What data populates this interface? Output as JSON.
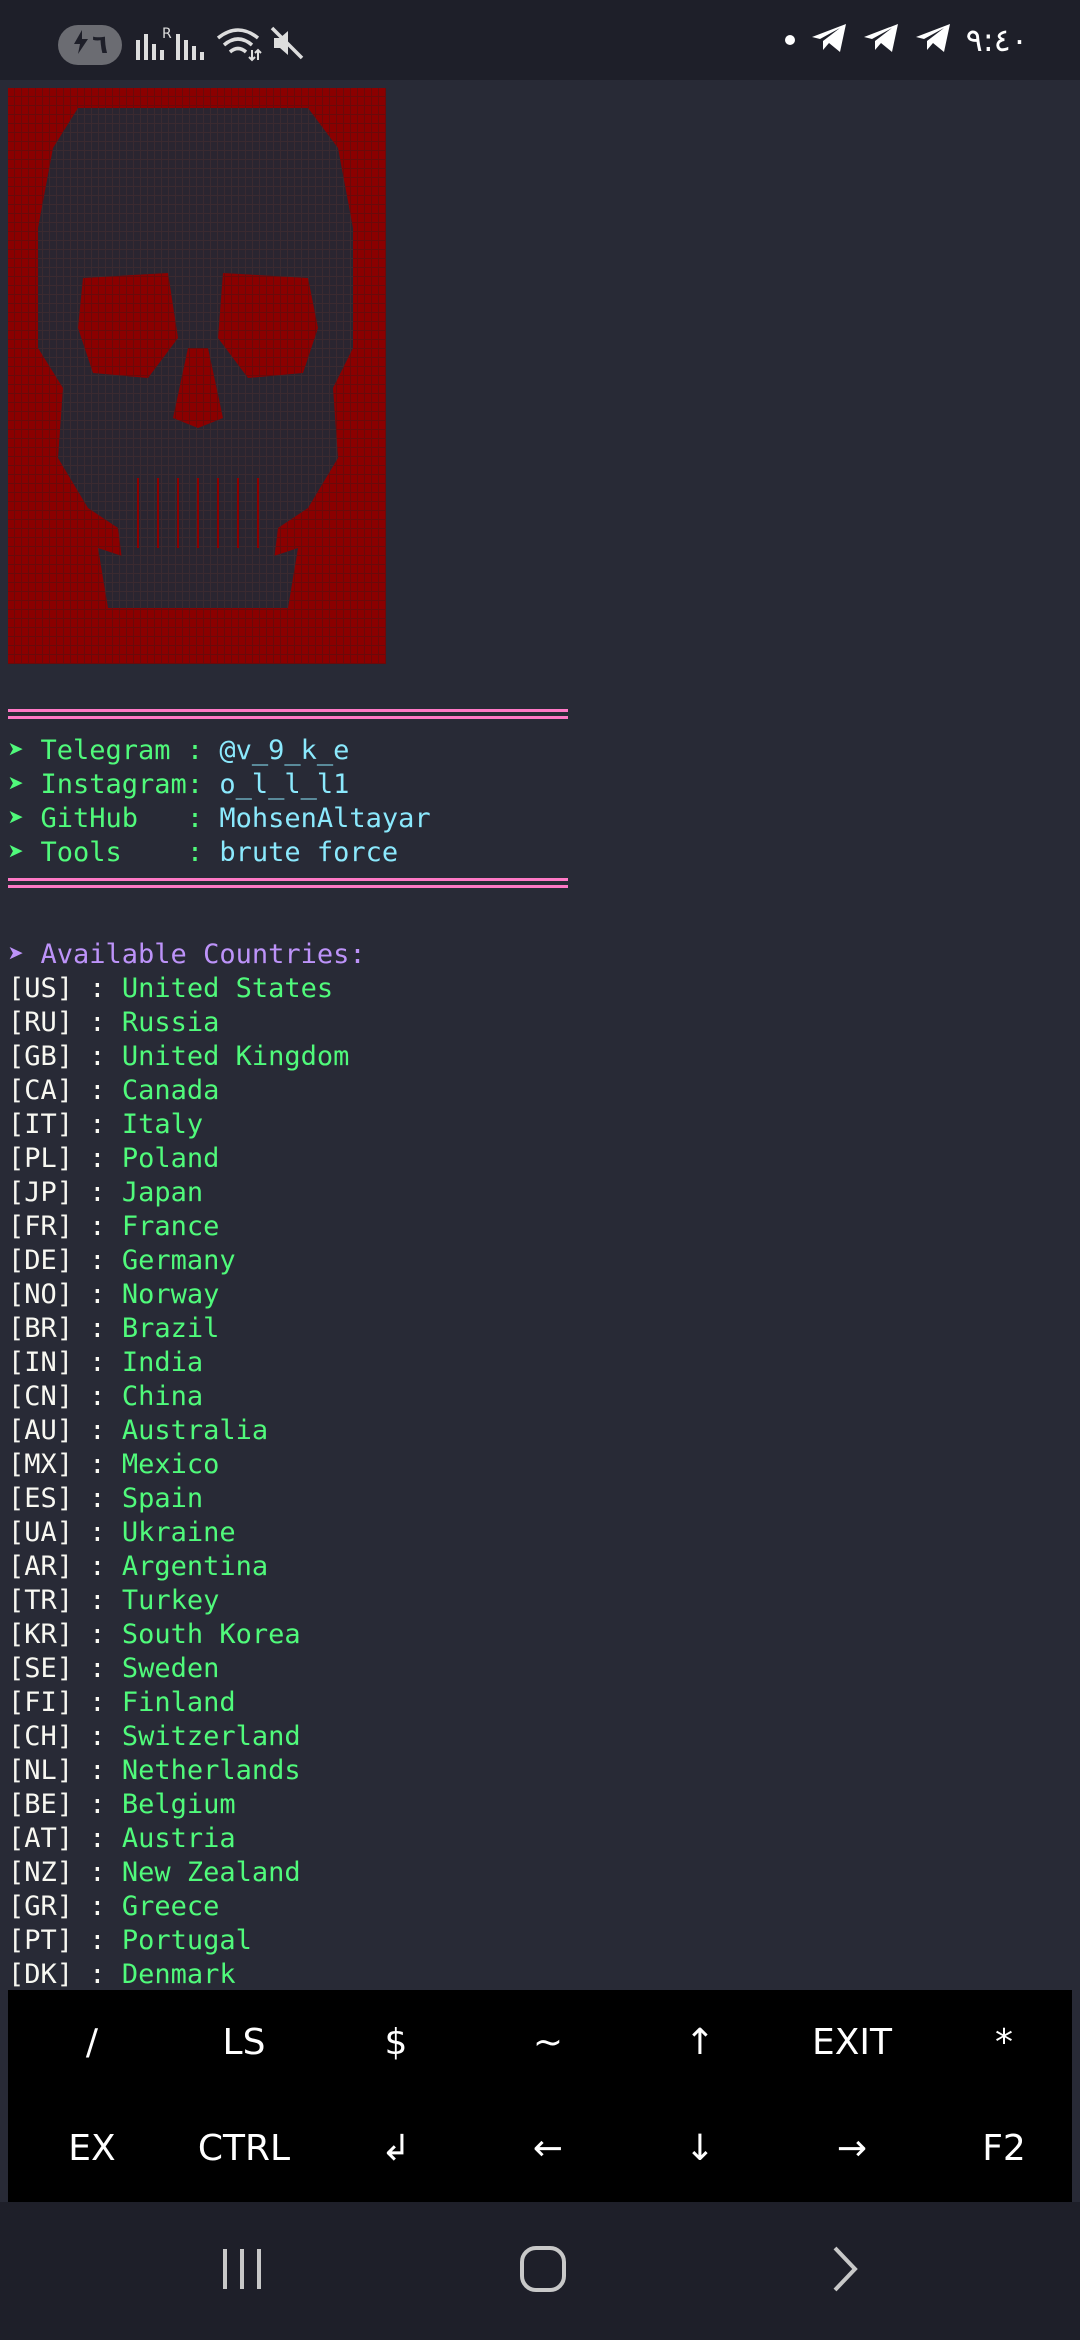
{
  "status_bar": {
    "clock": "٩:٤٠",
    "pill_text": "٦",
    "icons": [
      "charging-icon",
      "signal-r-icon",
      "signal-icon",
      "wifi-icon",
      "mute-icon",
      "dot-icon",
      "telegram-icon",
      "telegram-icon",
      "telegram-icon"
    ]
  },
  "terminal": {
    "info": [
      {
        "label": "Telegram : ",
        "value": "@v_9_k_e"
      },
      {
        "label": "Instagram: ",
        "value": "o_l_l_l1"
      },
      {
        "label": "GitHub   : ",
        "value": "MohsenAltayar"
      },
      {
        "label": "Tools    : ",
        "value": "brute force"
      }
    ],
    "countries_header": "Available Countries:",
    "countries": [
      {
        "code": "[US]",
        "name": "United States"
      },
      {
        "code": "[RU]",
        "name": "Russia"
      },
      {
        "code": "[GB]",
        "name": "United Kingdom"
      },
      {
        "code": "[CA]",
        "name": "Canada"
      },
      {
        "code": "[IT]",
        "name": "Italy"
      },
      {
        "code": "[PL]",
        "name": "Poland"
      },
      {
        "code": "[JP]",
        "name": "Japan"
      },
      {
        "code": "[FR]",
        "name": "France"
      },
      {
        "code": "[DE]",
        "name": "Germany"
      },
      {
        "code": "[NO]",
        "name": "Norway"
      },
      {
        "code": "[BR]",
        "name": "Brazil"
      },
      {
        "code": "[IN]",
        "name": "India"
      },
      {
        "code": "[CN]",
        "name": "China"
      },
      {
        "code": "[AU]",
        "name": "Australia"
      },
      {
        "code": "[MX]",
        "name": "Mexico"
      },
      {
        "code": "[ES]",
        "name": "Spain"
      },
      {
        "code": "[UA]",
        "name": "Ukraine"
      },
      {
        "code": "[AR]",
        "name": "Argentina"
      },
      {
        "code": "[TR]",
        "name": "Turkey"
      },
      {
        "code": "[KR]",
        "name": "South Korea"
      },
      {
        "code": "[SE]",
        "name": "Sweden"
      },
      {
        "code": "[FI]",
        "name": "Finland"
      },
      {
        "code": "[CH]",
        "name": "Switzerland"
      },
      {
        "code": "[NL]",
        "name": "Netherlands"
      },
      {
        "code": "[BE]",
        "name": "Belgium"
      },
      {
        "code": "[AT]",
        "name": "Austria"
      },
      {
        "code": "[NZ]",
        "name": "New Zealand"
      },
      {
        "code": "[GR]",
        "name": "Greece"
      },
      {
        "code": "[PT]",
        "name": "Portugal"
      },
      {
        "code": "[DK]",
        "name": "Denmark"
      }
    ],
    "colors": {
      "background": "#282a36",
      "code": "#f8f8f2",
      "country": "#50fa7b",
      "label": "#50fa7b",
      "value": "#8be9fd",
      "header": "#bd93f9",
      "separator": "#ff79c6",
      "skull_bg": "#8b0000"
    }
  },
  "extra_keys": {
    "row1": [
      "/",
      "LS",
      "$",
      "~",
      "↑",
      "EXIT",
      "*"
    ],
    "row2": [
      "EX",
      "CTRL",
      "↲",
      "←",
      "↓",
      "→",
      "F2"
    ]
  },
  "nav": {
    "icons": [
      "recents-icon",
      "home-icon",
      "back-icon"
    ]
  }
}
